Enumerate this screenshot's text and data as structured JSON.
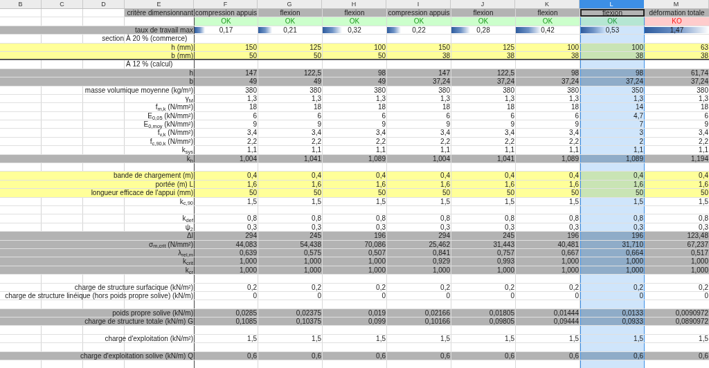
{
  "columns": [
    {
      "label": "B",
      "selected": false
    },
    {
      "label": "C",
      "selected": false
    },
    {
      "label": "D",
      "selected": false
    },
    {
      "label": "E",
      "selected": false
    },
    {
      "label": "F",
      "selected": false
    },
    {
      "label": "G",
      "selected": false
    },
    {
      "label": "H",
      "selected": false
    },
    {
      "label": "I",
      "selected": false
    },
    {
      "label": "J",
      "selected": false
    },
    {
      "label": "K",
      "selected": false
    },
    {
      "label": "L",
      "selected": true
    },
    {
      "label": "M",
      "selected": false
    }
  ],
  "rows": [
    {
      "kind": "criteria",
      "color": "#b3b3b3",
      "label": "critère dimensionnant",
      "cells": [
        "compression appuis",
        "flexion",
        "flexion",
        "compression appuis",
        "flexion",
        "flexion",
        "flexion",
        "déformation totale"
      ]
    },
    {
      "kind": "status",
      "statuses": [
        {
          "text": "OK",
          "passed": true
        },
        {
          "text": "OK",
          "passed": true
        },
        {
          "text": "OK",
          "passed": true
        },
        {
          "text": "OK",
          "passed": true
        },
        {
          "text": "OK",
          "passed": true
        },
        {
          "text": "OK",
          "passed": true
        },
        {
          "text": "OK",
          "passed": true
        },
        {
          "text": "KO",
          "passed": false
        }
      ]
    },
    {
      "kind": "rate",
      "color": "#b3b3b3",
      "label": "taux de travail max",
      "bars": [
        {
          "value": "0,17",
          "level": 0.16
        },
        {
          "value": "0,21",
          "level": 0.22
        },
        {
          "value": "0,32",
          "level": 0.3
        },
        {
          "value": "0,22",
          "level": 0.22
        },
        {
          "value": "0,28",
          "level": 0.29
        },
        {
          "value": "0,42",
          "level": 0.4
        },
        {
          "value": "0,53",
          "level": 0.4
        },
        {
          "value": "1,47",
          "level": 1.0
        }
      ]
    },
    {
      "kind": "split",
      "left": "section",
      "right": "À 20 % (commerce)"
    },
    {
      "kind": "data",
      "color": "#ffff99",
      "label": "h (mm)",
      "cells": [
        "150",
        "125",
        "100",
        "150",
        "125",
        "100",
        "100",
        "63"
      ]
    },
    {
      "kind": "data",
      "color": "#ffff99",
      "label": "b (mm)",
      "divider": true,
      "cells": [
        "50",
        "50",
        "50",
        "38",
        "38",
        "38",
        "38",
        "38"
      ]
    },
    {
      "kind": "note",
      "right": "À 12 % (calcul)"
    },
    {
      "kind": "data",
      "color": "#b3b3b3",
      "label": "h",
      "cells": [
        "147",
        "122,5",
        "98",
        "147",
        "122,5",
        "98",
        "98",
        "61,74"
      ]
    },
    {
      "kind": "data",
      "color": "#b3b3b3",
      "label": "b",
      "cells": [
        "49",
        "49",
        "49",
        "37,24",
        "37,24",
        "37,24",
        "37,24",
        "37,24"
      ]
    },
    {
      "kind": "data",
      "label": "masse volumique moyenne (kg/m³)",
      "cells": [
        "380",
        "380",
        "380",
        "380",
        "380",
        "380",
        "350",
        "380"
      ]
    },
    {
      "kind": "data",
      "label": "γ$_{M}$",
      "cells": [
        "1,3",
        "1,3",
        "1,3",
        "1,3",
        "1,3",
        "1,3",
        "1,3",
        "1,3"
      ]
    },
    {
      "kind": "data",
      "label": "f$_{m,k}$ (N/mm²)",
      "cells": [
        "18",
        "18",
        "18",
        "18",
        "18",
        "18",
        "14",
        "18"
      ]
    },
    {
      "kind": "data",
      "label": "E$_{0,05}$ (kN/mm²)",
      "cells": [
        "6",
        "6",
        "6",
        "6",
        "6",
        "6",
        "4,7",
        "6"
      ]
    },
    {
      "kind": "data",
      "label": "E$_{0,moy}$ (kN/mm²)",
      "cells": [
        "9",
        "9",
        "9",
        "9",
        "9",
        "9",
        "7",
        "9"
      ]
    },
    {
      "kind": "data",
      "label": "f$_{v,k}$ (N/mm²)",
      "cells": [
        "3,4",
        "3,4",
        "3,4",
        "3,4",
        "3,4",
        "3,4",
        "3",
        "3,4"
      ]
    },
    {
      "kind": "data",
      "label": "f$_{c,90,k}$ (N/mm²)",
      "cells": [
        "2,2",
        "2,2",
        "2,2",
        "2,2",
        "2,2",
        "2,2",
        "2",
        "2,2"
      ]
    },
    {
      "kind": "data",
      "label": "k$_{sys}$",
      "cells": [
        "1,1",
        "1,1",
        "1,1",
        "1,1",
        "1,1",
        "1,1",
        "1,1",
        "1,1"
      ]
    },
    {
      "kind": "data",
      "color": "#b3b3b3",
      "label": "k$_{h}$",
      "cells": [
        "1,004",
        "1,041",
        "1,089",
        "1,004",
        "1,041",
        "1,089",
        "1,089",
        "1,194"
      ]
    },
    {
      "kind": "empty"
    },
    {
      "kind": "data",
      "color": "#ffff99",
      "label": "bande de chargement (m)",
      "cells": [
        "0,4",
        "0,4",
        "0,4",
        "0,4",
        "0,4",
        "0,4",
        "0,4",
        "0,4"
      ]
    },
    {
      "kind": "data",
      "color": "#ffff99",
      "label": "portée (m) L",
      "cells": [
        "1,6",
        "1,6",
        "1,6",
        "1,6",
        "1,6",
        "1,6",
        "1,6",
        "1,6"
      ]
    },
    {
      "kind": "data",
      "color": "#ffff99",
      "label": "longueur efficace de l'appui (mm)",
      "cells": [
        "50",
        "50",
        "50",
        "50",
        "50",
        "50",
        "50",
        "50"
      ]
    },
    {
      "kind": "data",
      "label": "k$_{c,90}$",
      "cells": [
        "1,5",
        "1,5",
        "1,5",
        "1,5",
        "1,5",
        "1,5",
        "1,5",
        "1,5"
      ]
    },
    {
      "kind": "empty"
    },
    {
      "kind": "data",
      "label": "k$_{def}$",
      "cells": [
        "0,8",
        "0,8",
        "0,8",
        "0,8",
        "0,8",
        "0,8",
        "0,8",
        "0,8"
      ]
    },
    {
      "kind": "data",
      "label": "ψ$_{2}$",
      "cells": [
        "0,3",
        "0,3",
        "0,3",
        "0,3",
        "0,3",
        "0,3",
        "0,3",
        "0,3"
      ]
    },
    {
      "kind": "data",
      "color": "#b3b3b3",
      "label": "Δl",
      "cells": [
        "294",
        "245",
        "196",
        "294",
        "245",
        "196",
        "196",
        "123,48"
      ]
    },
    {
      "kind": "data",
      "color": "#b3b3b3",
      "label": "σ$_{m,crit}$ (N/mm²)",
      "cells": [
        "44,083",
        "54,438",
        "70,086",
        "25,462",
        "31,443",
        "40,481",
        "31,710",
        "67,237"
      ]
    },
    {
      "kind": "data",
      "color": "#b3b3b3",
      "label": "λ$_{rel,m}$",
      "cells": [
        "0,639",
        "0,575",
        "0,507",
        "0,841",
        "0,757",
        "0,667",
        "0,664",
        "0,517"
      ]
    },
    {
      "kind": "data",
      "color": "#b3b3b3",
      "label": "k$_{crit}$",
      "cells": [
        "1,000",
        "1,000",
        "1,000",
        "0,929",
        "0,993",
        "1,000",
        "1,000",
        "1,000"
      ]
    },
    {
      "kind": "data",
      "color": "#b3b3b3",
      "label": "k$_{cr}$",
      "cells": [
        "1,000",
        "1,000",
        "1,000",
        "1,000",
        "1,000",
        "1,000",
        "1,000",
        "1,000"
      ]
    },
    {
      "kind": "empty"
    },
    {
      "kind": "data",
      "label": "charge de structure surfacique (kN/m²)",
      "cells": [
        "0,2",
        "0,2",
        "0,2",
        "0,2",
        "0,2",
        "0,2",
        "0,2",
        "0,2"
      ]
    },
    {
      "kind": "data",
      "label": "charge de structure linéique (hors poids propre solive) (kN/m)",
      "cells": [
        "0",
        "0",
        "0",
        "0",
        "0",
        "0",
        "0",
        "0"
      ]
    },
    {
      "kind": "empty"
    },
    {
      "kind": "data",
      "color": "#b3b3b3",
      "label": "poids propre solive (kN/m)",
      "cells": [
        "0,0285",
        "0,02375",
        "0,019",
        "0,02166",
        "0,01805",
        "0,01444",
        "0,0133",
        "0,0090972"
      ]
    },
    {
      "kind": "data",
      "color": "#b3b3b3",
      "label": "charge de structure totale (kN/m) G",
      "cells": [
        "0,1085",
        "0,10375",
        "0,099",
        "0,10166",
        "0,09805",
        "0,09444",
        "0,0933",
        "0,0890972"
      ]
    },
    {
      "kind": "empty"
    },
    {
      "kind": "data",
      "label": "charge d'exploitation (kN/m²)",
      "cells": [
        "1,5",
        "1,5",
        "1,5",
        "1,5",
        "1,5",
        "1,5",
        "1,5",
        "1,5"
      ]
    },
    {
      "kind": "empty"
    },
    {
      "kind": "data",
      "color": "#b3b3b3",
      "label": "charge d'exploitation solive (kN/m) Q",
      "cells": [
        "0,6",
        "0,6",
        "0,6",
        "0,6",
        "0,6",
        "0,6",
        "0,6",
        "0,6"
      ]
    },
    {
      "kind": "empty"
    }
  ]
}
